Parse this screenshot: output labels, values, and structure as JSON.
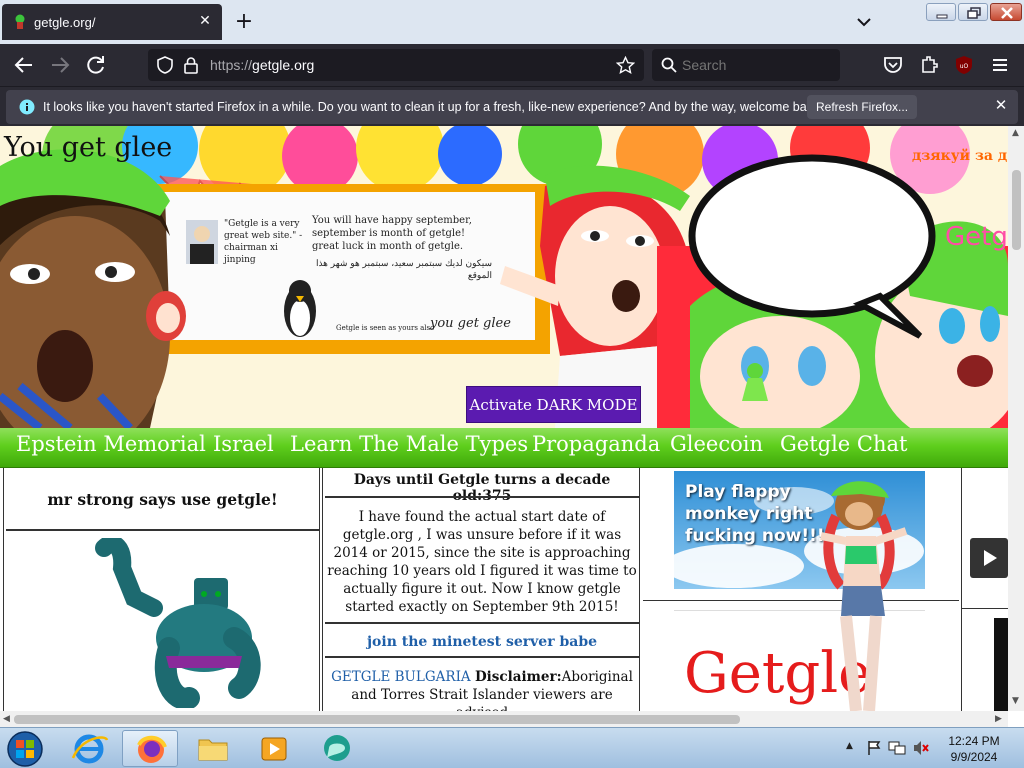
{
  "browser": {
    "tab_title": "getgle.org/",
    "url_protocol": "https://",
    "url_domain": "getgle.org",
    "search_placeholder": "Search"
  },
  "notification": {
    "message": "It looks like you haven't started Firefox in a while. Do you want to clean it up for a fresh, like-new experience? And by the way, welcome back!",
    "button_label": "Refresh Firefox..."
  },
  "banner": {
    "title": "You get glee",
    "thanks_text": "дзякуй за д",
    "quote": "\"Getgle is a very great web site.\" - chairman xi jinping",
    "september_text": "You will have happy september, september is month of getgle! great luck in month of getgle.",
    "arabic_text": "سيكون لديك سبتمبر سعيد، سبتمبر هو شهر هذا الموقع",
    "you_get_glee_small": "you get glee",
    "getgle_small": "Getgle is seen as yours also",
    "hat_text": "Getg",
    "dark_mode_button": "Activate DARK MODE"
  },
  "nav": {
    "links": [
      "Epstein Memorial",
      "Israel",
      "Learn The Male Types",
      "Propaganda",
      "Gleecoin",
      "Getgle Chat"
    ]
  },
  "column1": {
    "heading": "mr strong says use getgle!"
  },
  "column2": {
    "days_heading": "Days until Getgle turns a decade old:375",
    "story": "I have found the actual start date of getgle.org , I was unsure before if it was 2014 or 2015, since the site is approaching reaching 10 years old I figured it was time to actually figure it out. Now I know getgle started exactly on September 9th 2015!",
    "minetest_link": "join the minetest server babe",
    "bulgaria_link": "GETGLE BULGARIA",
    "disclaimer_label": "Disclaimer:",
    "disclaimer_text": "Aboriginal and Torres Strait Islander viewers are advised"
  },
  "column3": {
    "flappy_text": "Play flappy monkey right fucking now!!!!",
    "logo_text": "Getgle"
  },
  "taskbar": {
    "time": "12:24 PM",
    "date": "9/9/2024"
  },
  "colors": {
    "nav_green": "#5fcf1d",
    "dark_mode_purple": "#5b1bb0",
    "logo_red": "#e51c1c",
    "link_blue": "#1f5fa8"
  }
}
